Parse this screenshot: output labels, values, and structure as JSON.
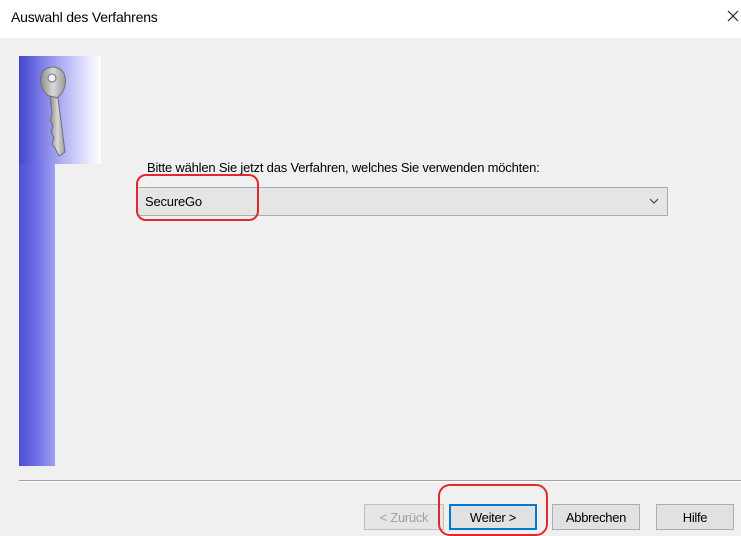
{
  "window": {
    "title": "Auswahl des Verfahrens",
    "close_glyph": "✕"
  },
  "content": {
    "prompt": "Bitte wählen Sie jetzt das Verfahren, welches Sie verwenden möchten:",
    "method_select": {
      "selected": "SecureGo"
    }
  },
  "buttons": {
    "back": "< Zurück",
    "next": "Weiter >",
    "cancel": "Abbrechen",
    "help": "Hilfe"
  },
  "colors": {
    "highlight": "#e0282f",
    "side_panel": "#5a5ade",
    "default_button_border": "#0078d7"
  },
  "icons": {
    "logo": "key-icon",
    "dropdown": "chevron-down-icon",
    "close": "close-icon"
  }
}
